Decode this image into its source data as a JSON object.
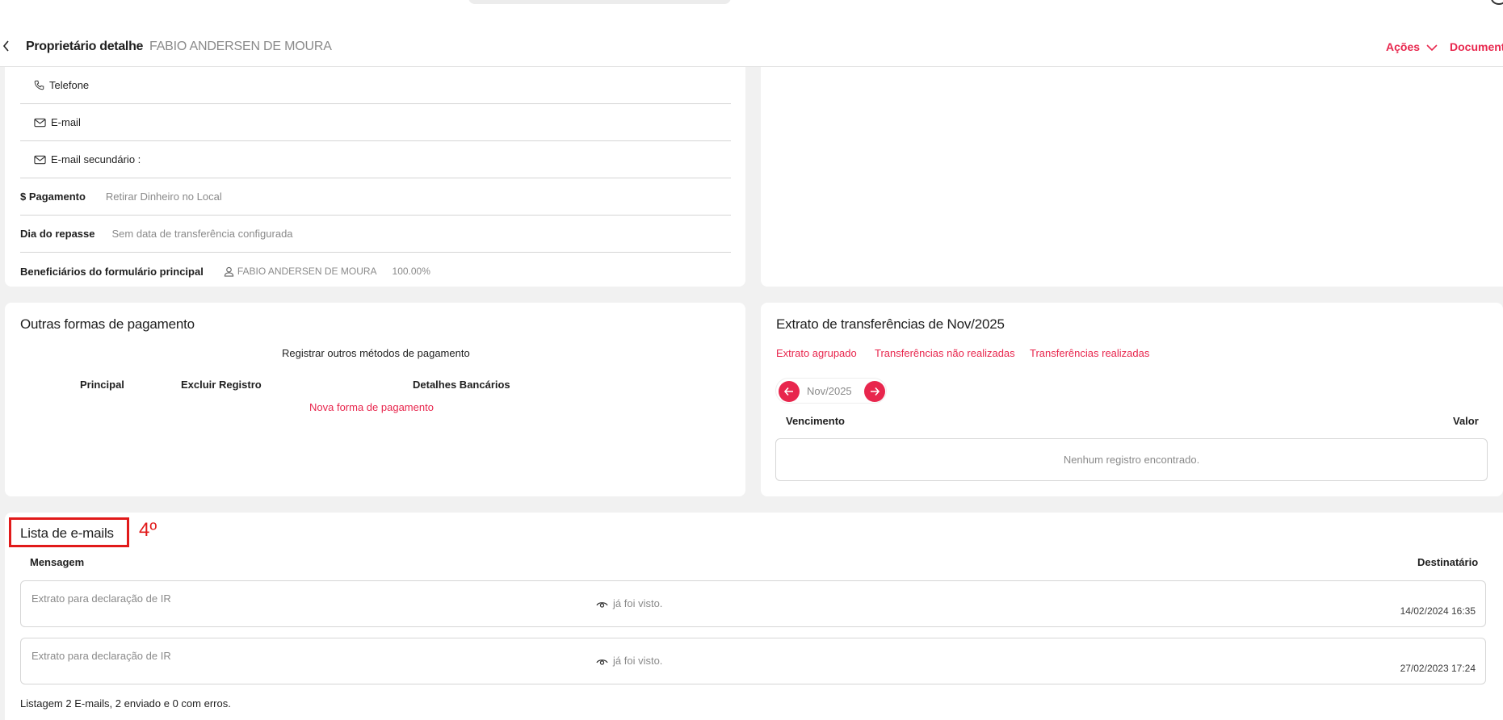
{
  "header": {
    "title": "Proprietário detalhe",
    "subtitle": "FABIO ANDERSEN DE MOURA",
    "actions_label": "Ações",
    "documents_label": "Documentos"
  },
  "owner_info": {
    "phone_label": "Telefone",
    "email_label": "E-mail",
    "secondary_email_label": "E-mail secundário :",
    "payment_label": "$ Pagamento",
    "payment_value": "Retirar Dinheiro no Local",
    "transfer_day_label": "Dia do repasse",
    "transfer_day_value": "Sem data de transferência configurada",
    "beneficiaries_label": "Beneficiários do formulário principal",
    "beneficiary_name": "FABIO ANDERSEN DE MOURA",
    "beneficiary_share": "100.00%"
  },
  "other_payments": {
    "title": "Outras formas de pagamento",
    "subtitle": "Registrar outros métodos de pagamento",
    "columns": [
      "Principal",
      "Excluir Registro",
      "Detalhes Bancários"
    ],
    "new_link": "Nova forma de pagamento"
  },
  "statement": {
    "title": "Extrato de transferências de Nov/2025",
    "tabs": [
      "Extrato agrupado",
      "Transferências não realizadas",
      "Transferências realizadas"
    ],
    "month": "Nov/2025",
    "col_due": "Vencimento",
    "col_value": "Valor",
    "empty": "Nenhum registro encontrado."
  },
  "emails": {
    "title": "Lista de e-mails",
    "step_marker": "4º",
    "col_message": "Mensagem",
    "col_recipient": "Destinatário",
    "rows": [
      {
        "message": "Extrato para declaração de IR",
        "status": "já foi visto.",
        "date": "14/02/2024 16:35"
      },
      {
        "message": "Extrato para declaração de IR",
        "status": "já foi visto.",
        "date": "27/02/2023 17:24"
      }
    ],
    "summary": "Listagem 2 E-mails, 2 enviado e 0 com erros."
  },
  "colors": {
    "accent": "#e8264d",
    "annotation": "#e11a1a"
  }
}
